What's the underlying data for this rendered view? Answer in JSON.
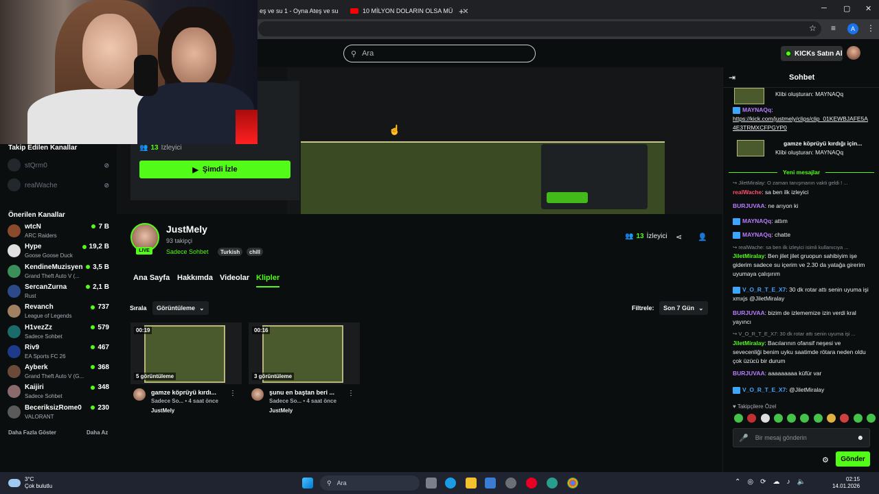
{
  "browser": {
    "tabs": [
      {
        "label": "eş ve su 1 - Oyna Ateş ve su"
      },
      {
        "label": "10 MİLYON DOLARIN OLSA MÜ"
      }
    ],
    "new_tab": "+",
    "win_min": "─",
    "win_max": "▢",
    "win_close": "✕"
  },
  "header": {
    "search_placeholder": "Ara",
    "buy_kicks": "KICKs Satın Al"
  },
  "sidebar": {
    "followed_title": "Takip Edilen Kanallar",
    "followed": [
      {
        "name": "stQrm0"
      },
      {
        "name": "realWache"
      }
    ],
    "recommended_title": "Önerilen Kanallar",
    "recommended": [
      {
        "name": "wtcN",
        "game": "ARC Raiders",
        "viewers": "7 B"
      },
      {
        "name": "Hype",
        "game": "Goose Goose Duck",
        "viewers": "19,2 B"
      },
      {
        "name": "KendineMuzisyen",
        "game": "Grand Theft Auto V (...",
        "viewers": "3,5 B"
      },
      {
        "name": "SercanZurna",
        "game": "Rust",
        "viewers": "2,1 B"
      },
      {
        "name": "Revanch",
        "game": "League of Legends",
        "viewers": "737"
      },
      {
        "name": "H1vezZz",
        "game": "Sadece Sohbet",
        "viewers": "579"
      },
      {
        "name": "Riv9",
        "game": "EA Sports FC 26",
        "viewers": "467"
      },
      {
        "name": "Ayberk",
        "game": "Grand Theft Auto V (G...",
        "viewers": "368"
      },
      {
        "name": "Kaijiri",
        "game": "Sadece Sohbet",
        "viewers": "348"
      },
      {
        "name": "BeceriksizRome0",
        "game": "VALORANT",
        "viewers": "230"
      }
    ],
    "show_more": "Daha Fazla Göster",
    "show_less": "Daha Az"
  },
  "preview": {
    "viewers_count": "13",
    "viewers_label": "İzleyici",
    "watch_now": "Şimdi İzle"
  },
  "channel": {
    "name": "JustMely",
    "followers": "93 takipçi",
    "category": "Sadece Sohbet",
    "tags": [
      "Turkish",
      "chill"
    ],
    "live": "LIVE",
    "viewers_count": "13",
    "viewers_label": "İzleyici",
    "tabs": [
      "Ana Sayfa",
      "Hakkımda",
      "Videolar",
      "Klipler"
    ]
  },
  "clips_filter": {
    "sort_label": "Sırala",
    "sort_value": "Görüntüleme",
    "filter_label": "Filtrele:",
    "filter_value": "Son 7 Gün"
  },
  "clips": [
    {
      "duration": "00:19",
      "views": "5 görüntüleme",
      "title": "gamze köprüyü kırdı...",
      "meta": "Sadece So... • 4 saat önce",
      "user": "JustMely"
    },
    {
      "duration": "00:16",
      "views": "3 görüntüleme",
      "title": "şunu en baştan beri ...",
      "meta": "Sadece So... • 4 saat önce",
      "user": "JustMely"
    }
  ],
  "chat": {
    "title": "Sohbet",
    "clip1_source": "Klibi oluşturan: MAYNAQq",
    "m_mayn_user": "MAYNAQq",
    "m_mayn_link": "https://kick.com/justmely/clips/clip_01KEWBJAFE5A4E3TRMXCFPGYP0",
    "clip2_title": "gamze köprüyü kırdığı için...",
    "clip2_source": "Klibi oluşturan: MAYNAQq",
    "new_messages": "Yeni mesajlar",
    "messages": [
      {
        "kind": "reply",
        "text": "↪ JiletMiralay: O zaman tanışmanın vakti geldi ! ..."
      },
      {
        "kind": "msg",
        "user": "realWache",
        "color": "#ff4d6d",
        "text": "sa ben ilk izleyici"
      },
      {
        "kind": "msg",
        "user": "BURJUVAA",
        "color": "#b77cff",
        "text": "ne arıyon ki"
      },
      {
        "kind": "msg",
        "user": "MAYNAQq",
        "color": "#b77cff",
        "text": "attım"
      },
      {
        "kind": "msg",
        "user": "MAYNAQq",
        "color": "#b77cff",
        "text": "chatte"
      },
      {
        "kind": "reply",
        "text": "↪ realWache: sa ben ilk izleyici isimli kullanıcıya ..."
      },
      {
        "kind": "msg",
        "user": "JiletMiralay",
        "color": "#53fc18",
        "text": "Ben jilet jilet gruopun sahibiyim işe giderim sadece su içerim ve 2.30 da yatağa girerim uyumaya çalışırım"
      },
      {
        "kind": "msg",
        "user": "V_O_R_T_E_X7",
        "color": "#3ea6ff",
        "text": "30 dk rotar attı senin uyuma işi xmxjs @JiletMiralay"
      },
      {
        "kind": "msg",
        "user": "BURJUVAA",
        "color": "#b77cff",
        "text": "bizim de izlememize izin verdi kral yayıncı"
      },
      {
        "kind": "reply",
        "text": "↪ V_O_R_T_E_X7: 30 dk rotar attı senin uyuma işi ..."
      },
      {
        "kind": "msg",
        "user": "JiletMiralay",
        "color": "#53fc18",
        "text": "Bacılarının ofansif neşesi ve sevecenliği benim uyku saatimde rötara neden oldu çok üzücü bir durum"
      },
      {
        "kind": "msg",
        "user": "BURJUVAA",
        "color": "#b77cff",
        "text": "aaaaaaaaa küfür var"
      },
      {
        "kind": "msg",
        "user": "V_O_R_T_E_X7",
        "color": "#3ea6ff",
        "text": "@JiletMiralay"
      }
    ],
    "sub_only": "♥ Takipçilere Özel",
    "input_placeholder": "Bir mesaj gönderin",
    "send": "Gönder"
  },
  "taskbar": {
    "temp": "3°C",
    "weather": "Çok bulutlu",
    "search": "Ara",
    "time": "02:15",
    "date": "14.01.2026"
  }
}
